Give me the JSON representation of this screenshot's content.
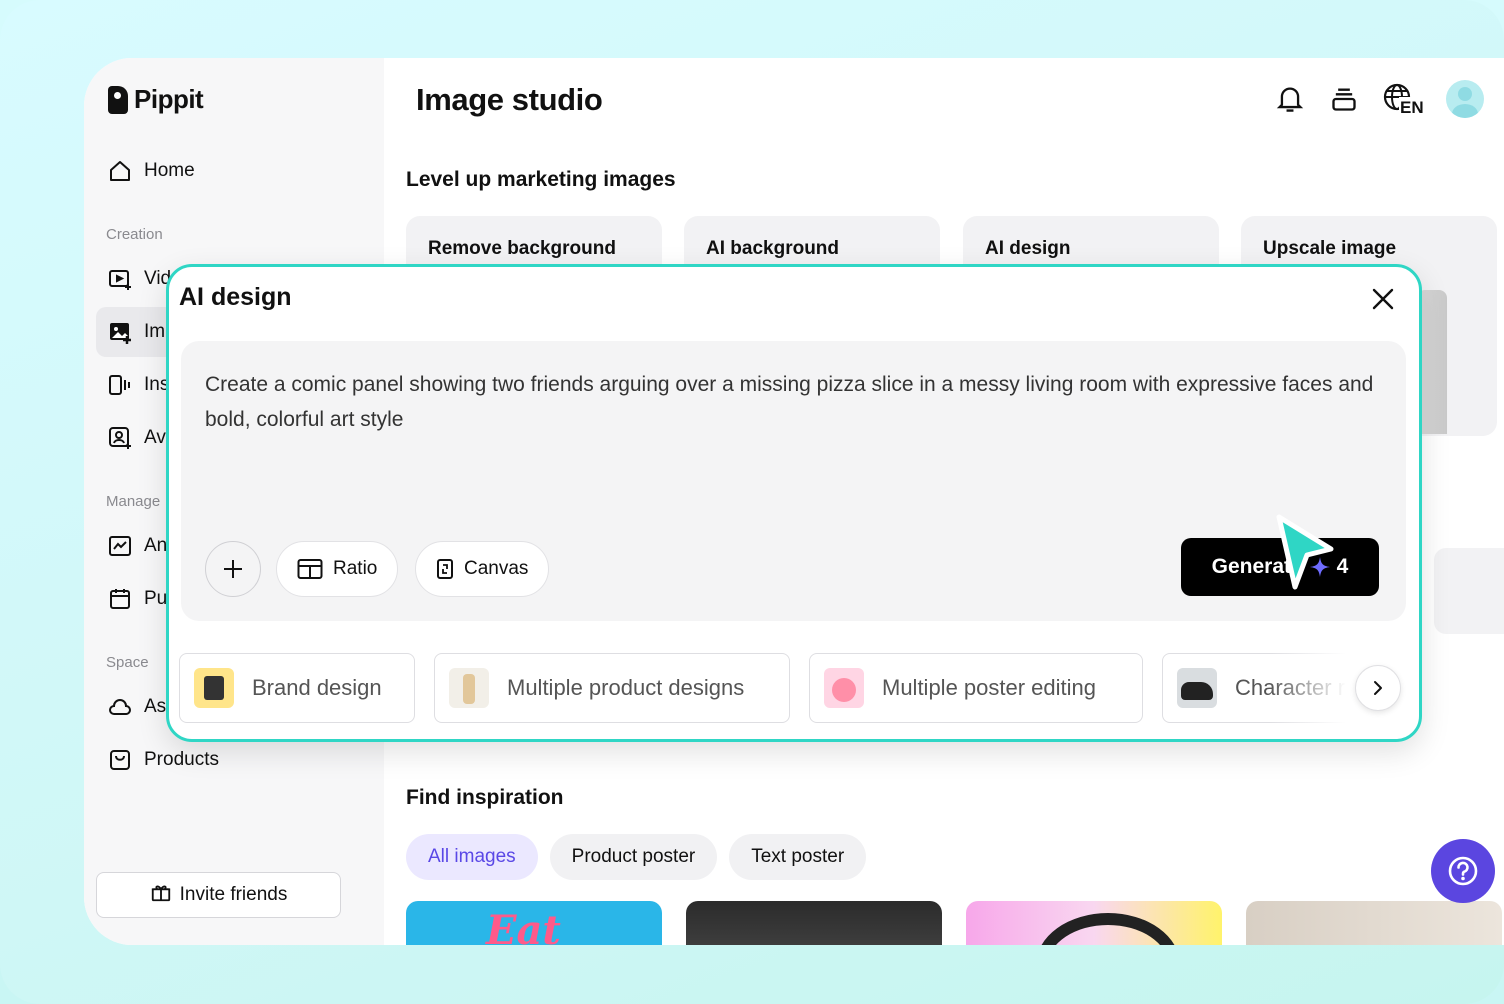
{
  "brand": {
    "name": "Pippit"
  },
  "header": {
    "title": "Image studio"
  },
  "sidebar": {
    "home_label": "Home",
    "sections": {
      "creation": "Creation",
      "manage": "Manage",
      "space": "Space"
    },
    "items": [
      {
        "label": "Vid"
      },
      {
        "label": "Im"
      },
      {
        "label": "Ins"
      },
      {
        "label": "Av"
      },
      {
        "label": "An"
      },
      {
        "label": "Pu"
      },
      {
        "label": "As"
      },
      {
        "label": "Products"
      }
    ],
    "invite_label": "Invite friends"
  },
  "marketing": {
    "heading": "Level up marketing images",
    "tools": [
      "Remove background",
      "AI background",
      "AI design",
      "Upscale image"
    ]
  },
  "modal": {
    "title": "AI design",
    "prompt": "Create a comic panel showing two friends arguing over a missing pizza slice in a messy living room with expressive faces and bold, colorful art style",
    "ratio_label": "Ratio",
    "canvas_label": "Canvas",
    "generate_label": "Generate",
    "generate_count": "4",
    "templates": [
      "Brand design",
      "Multiple product designs",
      "Multiple poster editing",
      "Character r"
    ]
  },
  "inspiration": {
    "heading": "Find inspiration",
    "filters": [
      "All images",
      "Product poster",
      "Text poster"
    ],
    "thumb1_text": "Eat"
  },
  "language": {
    "code": "EN"
  },
  "colors": {
    "accent": "#2fd6c5",
    "primary": "#5b46e0"
  }
}
